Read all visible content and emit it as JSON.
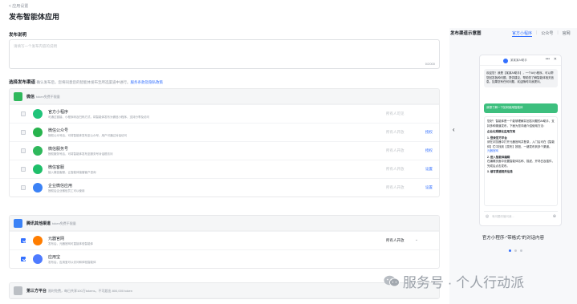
{
  "breadcrumb": "< 应用设置",
  "title": "发布智能体应用",
  "description": {
    "label": "发布说明",
    "placeholder": "请填写一个发布内容的说明",
    "counter": "0/2000"
  },
  "channels": {
    "label": "选择发布渠道",
    "note": "确认发布后，您将同意您的智能体发布至所选渠道中进行。",
    "link": "服务条款及隐私政策"
  },
  "groups": [
    {
      "name": "微信",
      "sub": "token免费不限量",
      "color": "#2fb85c",
      "rows": [
        {
          "name": "官方小程序",
          "desc": "可通过链接、小程序码及扫码方式，将智能体发布为微信小程序，支持分享及访问",
          "select": "所有人可见",
          "action": "",
          "checked": false,
          "icon": "#20c47a"
        },
        {
          "name": "微信公众号",
          "desc": "授权公众号后，可将智能体发布至公众号，用户可通过对话访问",
          "select": "所有人开放",
          "action": "授权",
          "checked": false,
          "icon": "#27b34d"
        },
        {
          "name": "微信服务号",
          "desc": "授权服务号后，可将智能体发布至服务号对话框访问",
          "select": "所有人开放",
          "action": "授权",
          "checked": false,
          "icon": "#2fb85c"
        },
        {
          "name": "微信客服",
          "desc": "接入微信客服，让智能体接管客户咨询",
          "select": "所有人开放",
          "action": "设置",
          "checked": false,
          "icon": "#1fbf6a"
        },
        {
          "name": "企业微信应用",
          "desc": "授权后企业微信员工可以使用",
          "select": "所有人开放",
          "action": "设置",
          "checked": false,
          "icon": "#3b82f6"
        }
      ]
    },
    {
      "name": "腾讯其他渠道",
      "sub": "token免费不限量",
      "color": "#3b82f6",
      "rows": [
        {
          "name": "元器官网",
          "desc": "发布后，元器官网可直接体验智能体",
          "select": "所有人开放",
          "action": "",
          "checked": true,
          "icon": "#ff7d00"
        },
        {
          "name": "应用宝",
          "desc": "发布后，应用宝可以访问和体验智能体",
          "select": "",
          "action": "",
          "checked": true,
          "icon": "#4e7bff"
        }
      ]
    },
    {
      "name": "第三方平台",
      "sub": "限时免费，每日共享100万tokens，不可超出 800,000 token",
      "color": "#bbbfc4",
      "rows": []
    }
  ],
  "preview": {
    "title": "发布渠道示意图",
    "tabs": [
      "官方小程序",
      "公众号",
      "官网"
    ],
    "phone_name": "某某某AI助手",
    "bubble1": "欢迎您！我是【某某AI助手】，一个AI小程序，可以帮您回答各种问题、提供建议、帮助您了解智能体相关信息。如果您有任何问题，欢迎随时向我提问。",
    "bubble2": "我想了解一下如何使用智能体",
    "answer_intro": "您好！智能体是一个能够理解并回答问题的AI助手，支持多种渠道发布，下面为您详细介绍使用方法：",
    "answer_head": "企业化规模化应用方案",
    "answer_p1": "1. 登录官方平台",
    "answer_p1d": "请在浏览器中打开元器官网并登录，入门后可在【智能体】栏中找到【发布】按钮，一键发布到多个渠道。",
    "answer_link": "元器官网",
    "answer_p2": "2. 进入智能体编辑",
    "answer_p2d": "在编辑页面中设置智能体名称、描述、开场白及插件，完成后点击发布。",
    "answer_p3": "3. 填写渠道相关信息",
    "input_placeholder": "有问题尽管问我…",
    "caption": "官方小程序-\"带格式\"的对话内容",
    "slides": 3
  },
  "watermark": "服务号 · 个人行动派"
}
